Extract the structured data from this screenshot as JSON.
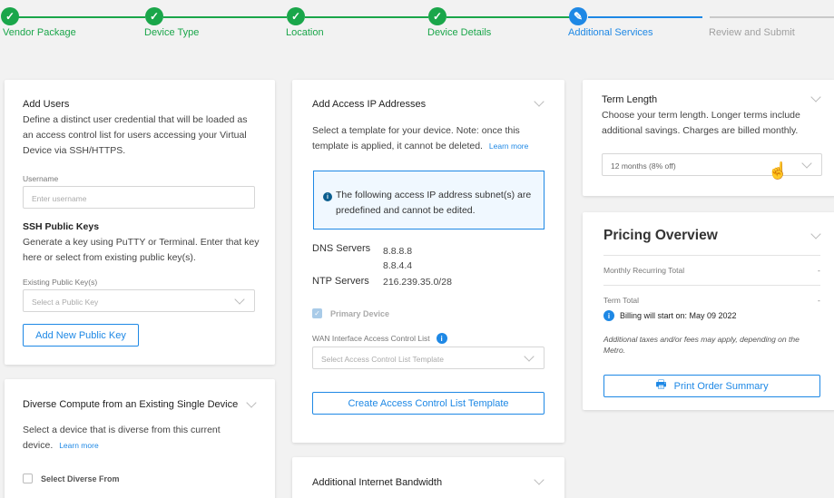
{
  "stepper": {
    "steps": [
      {
        "label": "Vendor Package",
        "state": "done"
      },
      {
        "label": "Device Type",
        "state": "done"
      },
      {
        "label": "Location",
        "state": "done"
      },
      {
        "label": "Device Details",
        "state": "done"
      },
      {
        "label": "Additional Services",
        "state": "active"
      },
      {
        "label": "Review and Submit",
        "state": "pending"
      }
    ],
    "colors": {
      "done": "#1aa64a",
      "active": "#1e88e5",
      "pending": "#a0a0a0"
    }
  },
  "add_users": {
    "title": "Add Users",
    "description": "Define a distinct user credential that will be loaded as an access control list for users accessing your Virtual Device via SSH/HTTPS.",
    "username_label": "Username",
    "username_placeholder": "Enter username",
    "ssh_title": "SSH Public Keys",
    "ssh_description": "Generate a key using PuTTY or Terminal. Enter that key here or select from existing public key(s).",
    "existing_key_label": "Existing Public Key(s)",
    "existing_key_placeholder": "Select a Public Key",
    "add_key_button": "Add New Public Key"
  },
  "diverse_compute": {
    "title": "Diverse Compute from an Existing Single Device",
    "description": "Select a device that is diverse from this current device.",
    "learn_more": "Learn more",
    "checkbox_label": "Select Diverse From"
  },
  "access_ip": {
    "title": "Add Access IP Addresses",
    "description": "Select a template for your device. Note: once this template is applied, it cannot be deleted.",
    "learn_more": "Learn more",
    "notice": "The following access IP address subnet(s) are predefined and cannot be edited.",
    "dns_label": "DNS Servers",
    "dns_1": "8.8.8.8",
    "dns_2": "8.8.4.4",
    "ntp_label": "NTP Servers",
    "ntp_value": "216.239.35.0/28",
    "primary_device_label": "Primary Device",
    "wan_acl_label": "WAN Interface Access Control List",
    "wan_acl_placeholder": "Select Access Control List Template",
    "create_acl_button": "Create Access Control List Template"
  },
  "bandwidth": {
    "title": "Additional Internet Bandwidth"
  },
  "term_length": {
    "title": "Term Length",
    "description": "Choose your term length. Longer terms include additional savings. Charges are billed monthly.",
    "selected": "12 months (8% off)"
  },
  "pricing": {
    "title": "Pricing Overview",
    "monthly_label": "Monthly Recurring Total",
    "monthly_value": "-",
    "term_total_label": "Term Total",
    "term_total_value": "-",
    "billing_start": "Billing will start on: May 09 2022",
    "taxes_note": "Additional taxes and/or fees may apply, depending on the Metro.",
    "print_button": "Print Order Summary"
  }
}
